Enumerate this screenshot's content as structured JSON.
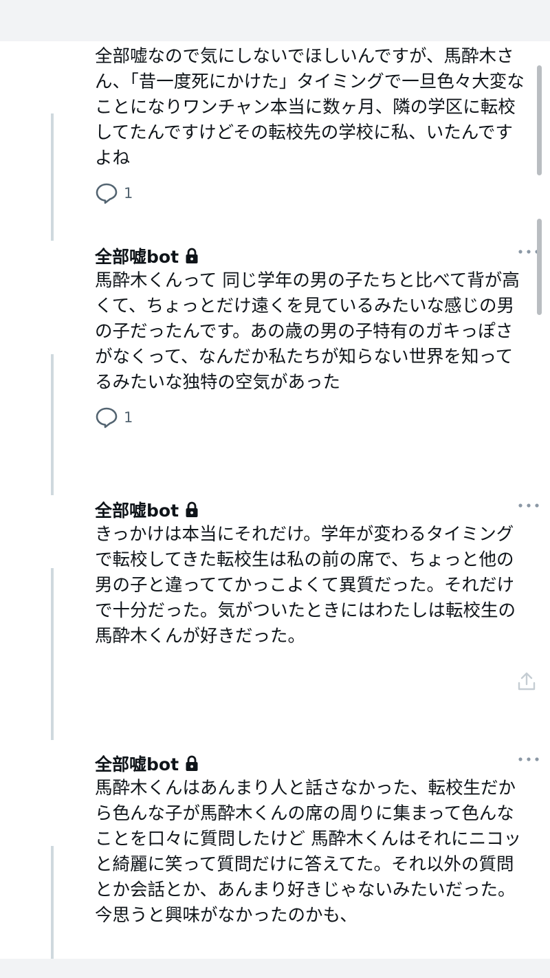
{
  "tweets": [
    {
      "author": "",
      "text": "全部嘘なので気にしないでほしいんですが、馬酔木さん、「昔一度死にかけた」タイミングで一旦色々大変なことになりワンチャン本当に数ヶ月、隣の学区に転校してたんですけどその転校先の学校に私、いたんですよね",
      "reply_count": "1"
    },
    {
      "author": "全部嘘bot",
      "text": "馬酔木くんって 同じ学年の男の子たちと比べて背が高くて、ちょっとだけ遠くを見ているみたいな感じの男の子だったんです。あの歳の男の子特有のガキっぽさがなくって、なんだか私たちが知らない世界を知ってるみたいな独特の空気があった",
      "reply_count": "1"
    },
    {
      "author": "全部嘘bot",
      "text": "きっかけは本当にそれだけ。学年が変わるタイミングで転校してきた転校生は私の前の席で、ちょっと他の男の子と違っててかっこよくて異質だった。それだけで十分だった。気がついたときにはわたしは転校生の馬酔木くんが好きだった。",
      "reply_count": ""
    },
    {
      "author": "全部嘘bot",
      "text": "馬酔木くんはあんまり人と話さなかった、転校生だから色んな子が馬酔木くんの席の周りに集まって色んなことを口々に質問したけど 馬酔木くんはそれにニコッと綺麗に笑って質問だけに答えてた。それ以外の質問とか会話とか、あんまり好きじゃないみたいだった。今思うと興味がなかったのかも、",
      "reply_count": ""
    }
  ],
  "icons": {
    "lock": "lock-icon",
    "more": "more-icon",
    "reply": "reply-icon",
    "share": "share-icon"
  },
  "colors": {
    "text": "#0f1419",
    "secondary": "#536471",
    "thread_line": "#cfd9de"
  }
}
